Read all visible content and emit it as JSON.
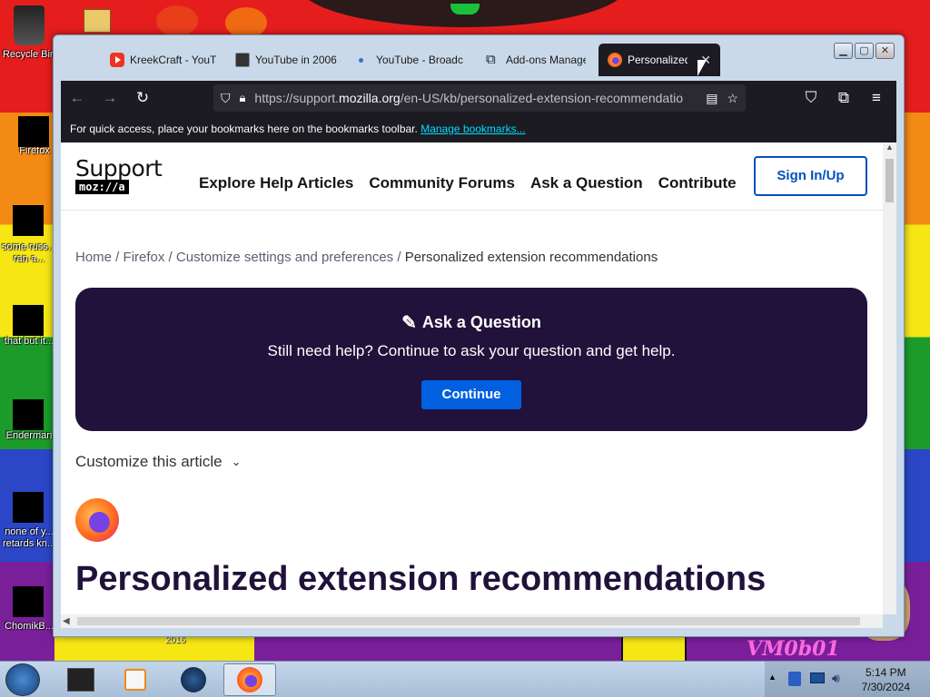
{
  "desktop": {
    "icons": [
      {
        "label": "Recycle Bin"
      },
      {
        "label": "Firefox"
      },
      {
        "label": "some russ... ran a..."
      },
      {
        "label": "that but it..."
      },
      {
        "label": "Enderman"
      },
      {
        "label": "none of y... retards kn..."
      },
      {
        "label": "ChomikB..."
      }
    ],
    "bottom_text": "2016",
    "watermark": "VM0b01"
  },
  "browser": {
    "tabs": [
      {
        "label": "KreekCraft - YouT",
        "icon": "youtube-icon"
      },
      {
        "label": "YouTube in 2006 -",
        "icon": "page-icon"
      },
      {
        "label": "YouTube - Broadc",
        "icon": "loading-dot-icon"
      },
      {
        "label": "Add-ons Manager",
        "icon": "puzzle-icon"
      },
      {
        "label": "Personalized e",
        "icon": "firefox-icon",
        "active": true
      }
    ],
    "url_prefix": "https://support.",
    "url_domain": "mozilla.org",
    "url_suffix": "/en-US/kb/personalized-extension-recommendatio",
    "bookmarks_hint": "For quick access, place your bookmarks here on the bookmarks toolbar.",
    "bookmarks_link": "Manage bookmarks..."
  },
  "page": {
    "logo_text": "Support",
    "logo_sub": "moz://a",
    "nav": [
      "Explore Help Articles",
      "Community Forums",
      "Ask a Question",
      "Contribute"
    ],
    "signin": "Sign In/Up",
    "breadcrumbs": [
      "Home",
      "Firefox",
      "Customize settings and preferences"
    ],
    "breadcrumb_current": "Personalized extension recommendations",
    "ask_title": "Ask a Question",
    "ask_subtitle": "Still need help? Continue to ask your question and get help.",
    "continue_label": "Continue",
    "customize_label": "Customize this article",
    "article_title": "Personalized extension recommendations"
  },
  "taskbar": {
    "time": "5:14 PM",
    "date": "7/30/2024"
  }
}
